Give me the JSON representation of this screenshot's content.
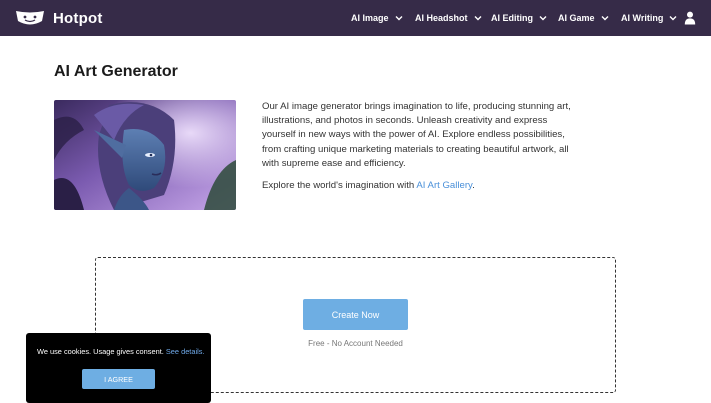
{
  "header": {
    "brand_name": "Hotpot",
    "nav_items": [
      {
        "label": "AI Image"
      },
      {
        "label": "AI Headshot"
      },
      {
        "label": "AI Editing"
      },
      {
        "label": "AI Game"
      },
      {
        "label": "AI Writing"
      }
    ],
    "icons": {
      "logo": "hotpot-logo-icon",
      "chevron": "chevron-down-icon",
      "user": "user-icon"
    }
  },
  "main": {
    "title": "AI Art Generator",
    "description": "Our AI image generator brings imagination to life, producing stunning art, illustrations, and photos in seconds. Unleash creativity and express yourself in new ways with the power of AI. Explore endless possibilities, from crafting unique marketing materials to creating beautiful artwork, all with supreme ease and efficiency.",
    "explore_prefix": "Explore the world's imagination with ",
    "explore_link": "AI Art Gallery",
    "explore_suffix": "."
  },
  "create": {
    "button_label": "Create Now",
    "subtext": "Free - No Account Needed"
  },
  "cookie": {
    "text": "We use cookies. Usage gives consent.",
    "link": "See details.",
    "button_label": "I AGREE"
  },
  "colors": {
    "header_bg": "#362b48",
    "accent": "#6eaee3",
    "link": "#4a90d9"
  }
}
